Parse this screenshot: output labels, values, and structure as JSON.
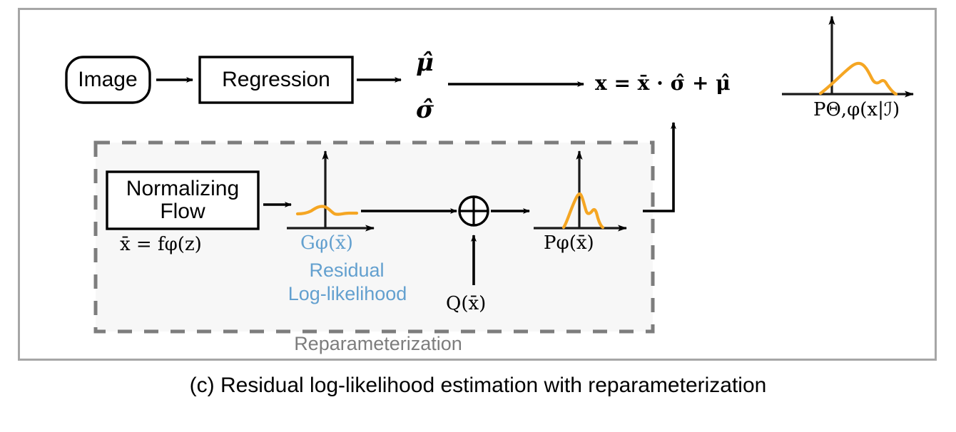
{
  "figure": {
    "caption": "(c) Residual log-likelihood estimation with reparameterization",
    "frame_color": "#a6a6a6",
    "background": "#ffffff"
  },
  "colors": {
    "curve_orange": "#f5a623",
    "label_blue": "#63a0cf",
    "dashed_gray": "#7d7d7d",
    "panel_fill": "#f7f7f7",
    "stroke_black": "#000000"
  },
  "nodes": {
    "image_box": {
      "label": "Image",
      "shape": "rounded-rect"
    },
    "regression_box": {
      "label": "Regression",
      "shape": "rect"
    },
    "normalizing_flow_box": {
      "label": "Normalizing\nFlow",
      "shape": "rect"
    },
    "sum_operator": {
      "label": "⊕",
      "shape": "circle-plus"
    }
  },
  "math": {
    "mu_hat": "μ̂",
    "sigma_hat": "σ̂",
    "main_equation": "x = x̄ · σ̂ + μ̂",
    "flow_equation": "x̄ = fφ(z)",
    "p_theta_phi": "PΘ,φ(x|ℐ)",
    "g_phi": "Gφ(x̄)",
    "p_phi": "Pφ(x̄)",
    "q_xbar": "Q(x̄)"
  },
  "annotations": {
    "residual": "Residual",
    "log_likelihood": "Log-likelihood",
    "reparameterization": "Reparameterization"
  },
  "chart_data": [
    {
      "type": "line",
      "name": "residual-log-likelihood-plot",
      "title": "Gφ(x̄)",
      "description": "near-flat wavy residual log-likelihood curve with small central bump",
      "axes": {
        "x_arrow": true,
        "y_arrow": true,
        "grid": false
      },
      "x": [
        0,
        0.1,
        0.2,
        0.3,
        0.4,
        0.5,
        0.6,
        0.7,
        0.8,
        0.9,
        1.0
      ],
      "values": [
        0.12,
        0.14,
        0.18,
        0.3,
        0.42,
        0.34,
        0.2,
        0.14,
        0.18,
        0.17,
        0.15
      ]
    },
    {
      "type": "line",
      "name": "reparameterized-distribution-plot",
      "title": "Pφ(x̄)",
      "description": "sharply peaked unimodal curve with a shoulder bump on the right",
      "axes": {
        "x_arrow": true,
        "y_arrow": true,
        "grid": false
      },
      "x": [
        0,
        0.1,
        0.2,
        0.3,
        0.4,
        0.5,
        0.6,
        0.7,
        0.8,
        0.9,
        1.0
      ],
      "values": [
        0.0,
        0.06,
        0.3,
        0.66,
        1.0,
        0.72,
        0.5,
        0.54,
        0.4,
        0.14,
        0.0
      ]
    },
    {
      "type": "line",
      "name": "output-distribution-plot",
      "title": "PΘ,φ(x|ℐ)",
      "description": "broad right-skewed distribution with a shoulder bump after the peak",
      "axes": {
        "x_arrow": true,
        "y_arrow": true,
        "grid": false
      },
      "x": [
        0,
        0.1,
        0.2,
        0.3,
        0.4,
        0.5,
        0.6,
        0.7,
        0.8,
        0.9,
        1.0
      ],
      "values": [
        0.0,
        0.14,
        0.36,
        0.6,
        0.86,
        1.0,
        0.74,
        0.6,
        0.62,
        0.4,
        0.08
      ]
    }
  ]
}
